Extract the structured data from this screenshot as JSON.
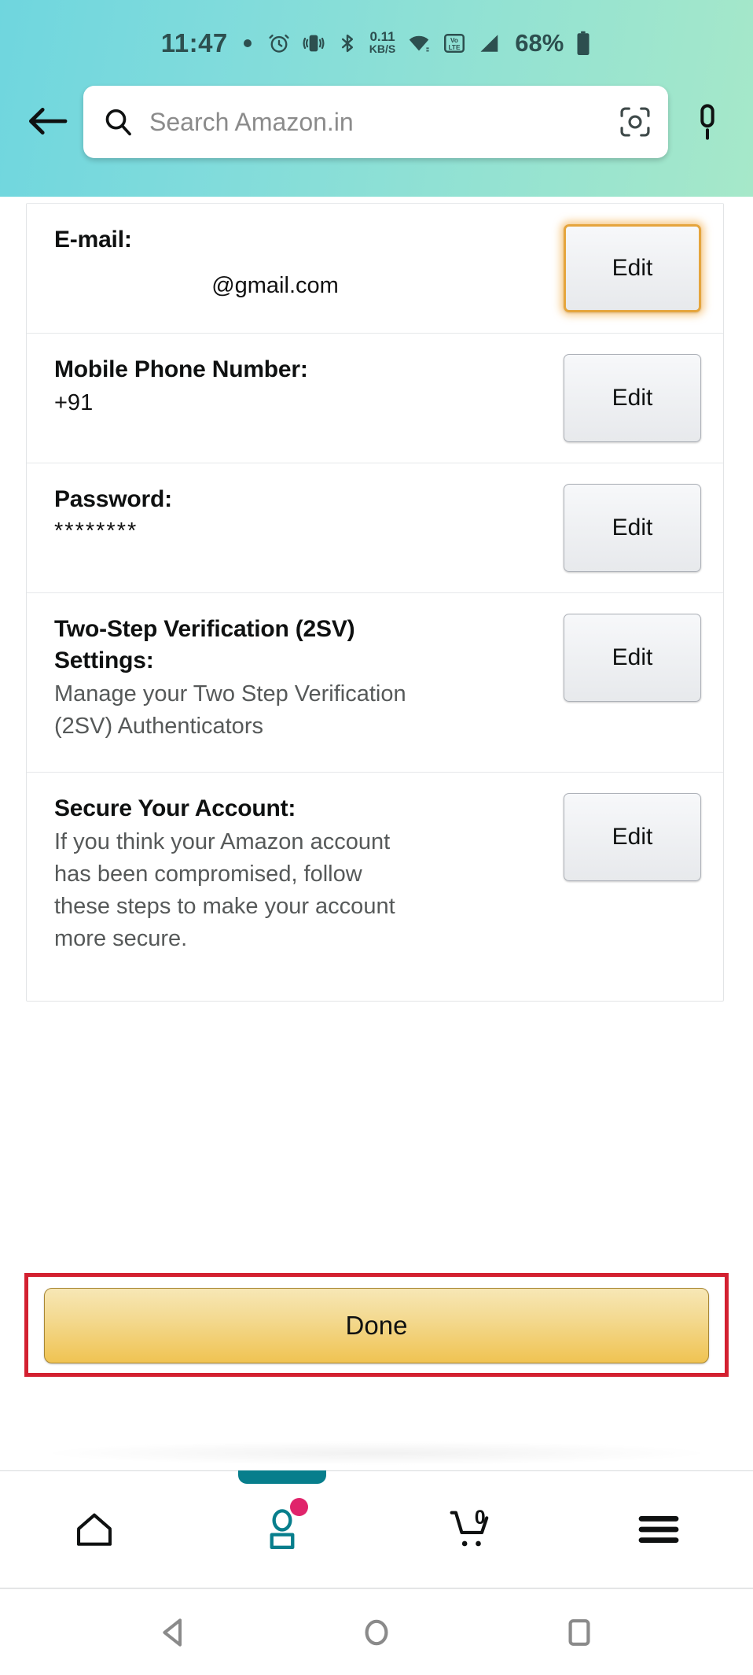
{
  "status_bar": {
    "time": "11:47",
    "data_speed_value": "0.11",
    "data_speed_unit": "KB/S",
    "battery_percent": "68%",
    "icons": [
      "alarm-icon",
      "vibrate-icon",
      "bluetooth-icon",
      "wifi-icon",
      "volte-icon",
      "signal-icon",
      "battery-icon"
    ]
  },
  "header": {
    "back_label": "Back",
    "search": {
      "placeholder": "Search Amazon.in",
      "value": ""
    },
    "camera_label": "Search by image",
    "mic_label": "Voice search"
  },
  "account_rows": [
    {
      "label": "E-mail:",
      "value": "@gmail.com",
      "desc": "",
      "button": "Edit",
      "focused": true
    },
    {
      "label": "Mobile Phone Number:",
      "value": "+91",
      "desc": "",
      "button": "Edit",
      "focused": false
    },
    {
      "label": "Password:",
      "value": "********",
      "desc": "",
      "button": "Edit",
      "focused": false
    },
    {
      "label": "Two-Step Verification (2SV) Settings:",
      "value": "",
      "desc": "Manage your Two Step Verification (2SV) Authenticators",
      "button": "Edit",
      "focused": false
    },
    {
      "label": "Secure Your Account:",
      "value": "",
      "desc": "If you think your Amazon account has been compromised, follow these steps to make your account more secure.",
      "button": "Edit",
      "focused": false
    }
  ],
  "done": {
    "label": "Done"
  },
  "bottom_nav": {
    "items": [
      {
        "name": "home",
        "icon": "home-icon",
        "active": false,
        "badge": false,
        "count": ""
      },
      {
        "name": "profile",
        "icon": "person-icon",
        "active": true,
        "badge": true,
        "count": ""
      },
      {
        "name": "cart",
        "icon": "cart-icon",
        "active": false,
        "badge": false,
        "count": "0"
      },
      {
        "name": "menu",
        "icon": "hamburger-menu-icon",
        "active": false,
        "badge": false,
        "count": ""
      }
    ]
  },
  "android_nav": {
    "back": "back-triangle-icon",
    "home": "home-circle-icon",
    "recents": "recents-square-icon"
  },
  "colors": {
    "header_start": "#6fd6de",
    "header_end": "#a6e8c9",
    "accent_teal": "#077e8c",
    "badge_pink": "#e0246b",
    "done_gold": "#f0c352",
    "focus_orange": "#e5a53d",
    "annotation_red": "#d32030"
  }
}
